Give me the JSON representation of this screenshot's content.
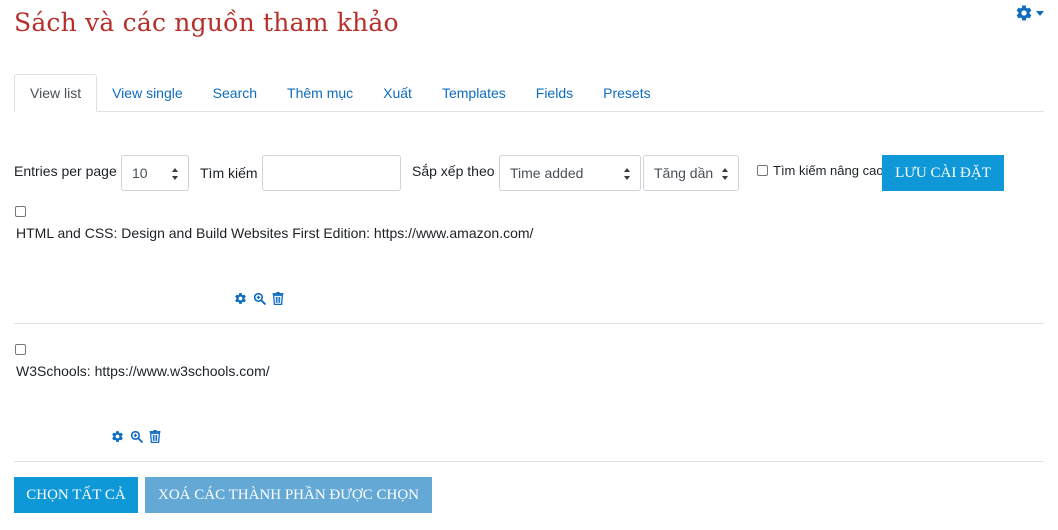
{
  "page": {
    "title": "Sách và các nguồn tham khảo"
  },
  "tabs": [
    {
      "label": "View list",
      "active": true
    },
    {
      "label": "View single"
    },
    {
      "label": "Search"
    },
    {
      "label": "Thêm mục"
    },
    {
      "label": "Xuất"
    },
    {
      "label": "Templates"
    },
    {
      "label": "Fields"
    },
    {
      "label": "Presets"
    }
  ],
  "toolbar": {
    "entries_label": "Entries per page",
    "entries_value": "10",
    "search_label": "Tìm kiếm",
    "search_value": "",
    "sort_label": "Sắp xếp theo",
    "sort_value": "Time added",
    "order_value": "Tăng dần",
    "advanced_label": "Tìm kiếm nâng cao",
    "save_label": "LƯU CÀI ĐẶT"
  },
  "entries": [
    {
      "text": "HTML and CSS: Design and Build Websites First Edition: https://www.amazon.com/"
    },
    {
      "text": "W3Schools: https://www.w3schools.com/"
    }
  ],
  "footer": {
    "select_all_label": "CHỌN TẤT CẢ",
    "delete_selected_label": "XOÁ CÁC THÀNH PHẦN ĐƯỢC CHỌN"
  },
  "icons": {
    "settings": "gear-icon",
    "edit": "gear-icon",
    "view": "zoom-icon",
    "delete": "trash-icon"
  },
  "colors": {
    "title": "#b5302b",
    "link": "#0f6cbf",
    "primary_button": "#0f98d8",
    "secondary_button": "#64a9d6"
  }
}
